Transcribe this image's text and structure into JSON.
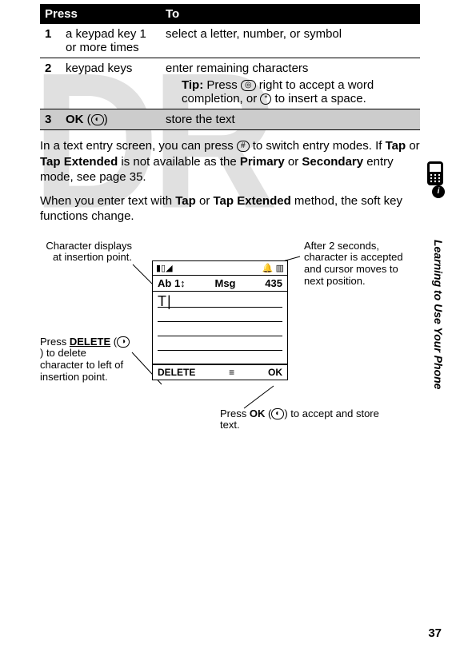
{
  "watermark": "DR",
  "table": {
    "h1": "Press",
    "h2": "To",
    "r1_num": "1",
    "r1_press": "a keypad key 1 or more times",
    "r1_to": "select a letter, number, or symbol",
    "r2_num": "2",
    "r2_press": "keypad keys",
    "r2_to": "enter remaining characters",
    "r2_tip_label": "Tip:",
    "r2_tip_text": " Press ",
    "r2_tip_nav": "◎",
    "r2_tip_after_nav": " right to accept a word completion, or ",
    "r2_tip_star": "*",
    "r2_tip_end": " to insert a space.",
    "r3_num": "3",
    "r3_press_ok": "OK",
    "r3_press_paren": " (",
    "r3_press_softkey": "◐",
    "r3_press_close": ")",
    "r3_to": "store the text"
  },
  "para1_a": "In a text entry screen, you can press ",
  "para1_hash": "#",
  "para1_b": " to switch entry modes. If ",
  "para1_tap": "Tap",
  "para1_or": " or ",
  "para1_tapext": "Tap Extended",
  "para1_c": " is not available as the ",
  "para1_primary": "Primary",
  "para1_d": " or ",
  "para1_secondary": "Secondary",
  "para1_e": " entry mode, see page 35.",
  "para2_a": "When you enter text with ",
  "para2_tap": "Tap",
  "para2_or": " or ",
  "para2_tapext": "Tap Extended",
  "para2_b": " method, the soft key functions change.",
  "callouts": {
    "left1": "Character displays at insertion point.",
    "left2_a": "Press ",
    "left2_delete": "DELETE",
    "left2_b": " (",
    "left2_soft": "◑",
    "left2_c": ") to delete character to left of insertion point.",
    "right1": "After 2 seconds, character is accepted and cursor moves to next position.",
    "bottom_a": "Press ",
    "bottom_ok": "OK",
    "bottom_b": " (",
    "bottom_soft": "◐",
    "bottom_c": ") to accept and store text."
  },
  "screen": {
    "signal": "▮▯◢",
    "ring": "🔔",
    "batt": "▥",
    "mode": "Ab 1",
    "mode_icon": "↕",
    "title": "Msg",
    "count": "435",
    "typed": "T",
    "cursor": "|",
    "soft_left": "DELETE",
    "soft_menu": "≡",
    "soft_right": "OK"
  },
  "side_label": "Learning to Use Your Phone",
  "info": "i",
  "page": "37"
}
